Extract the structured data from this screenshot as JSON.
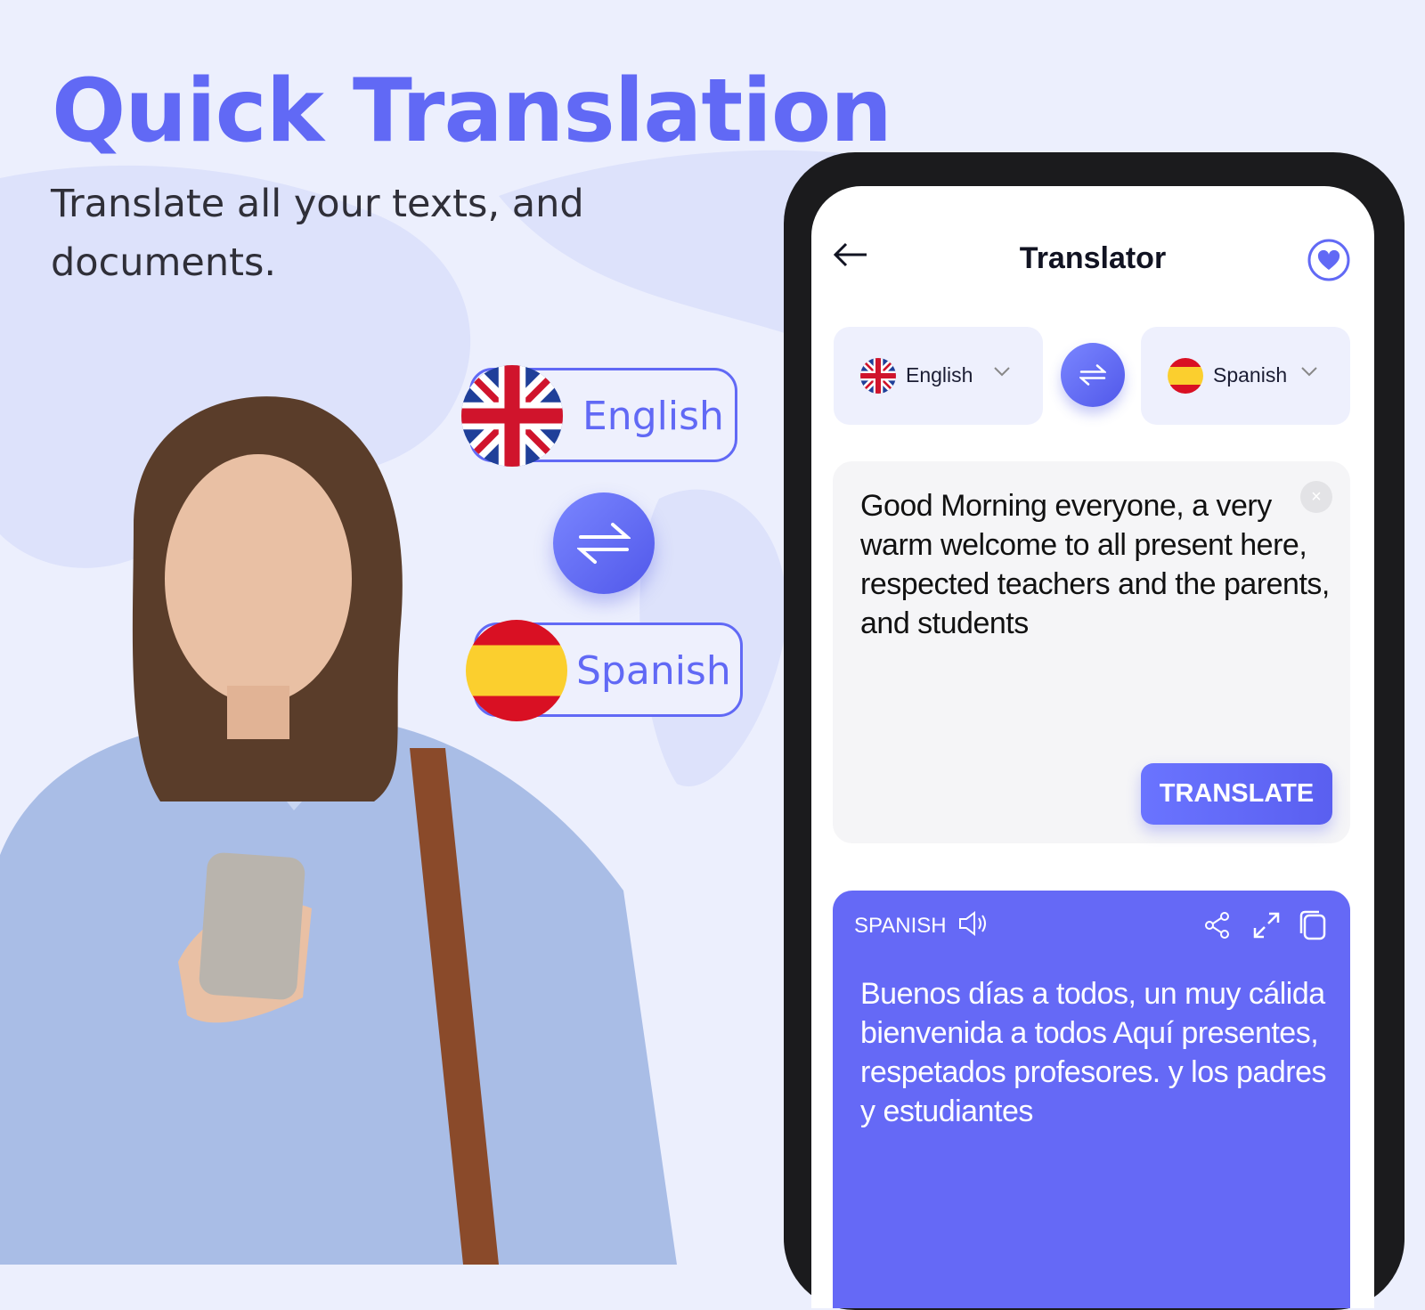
{
  "hero": {
    "title": "Quick Translation",
    "subtitle": "Translate all your texts, and documents."
  },
  "promo": {
    "source_lang": "English",
    "target_lang": "Spanish"
  },
  "app": {
    "title": "Translator",
    "source_lang": "English",
    "target_lang": "Spanish",
    "input_text": "Good Morning everyone, a very warm welcome to all present here, respected teachers and the parents, and students",
    "translate_label": "TRANSLATE",
    "output_label": "SPANISH",
    "output_text": "Buenos días a todos, un muy cálida bienvenida a todos Aquí presentes, respetados profesores. y los padres y estudiantes"
  },
  "colors": {
    "accent": "#6169f5",
    "output_bg": "#6569f6",
    "background": "#eceffd"
  }
}
